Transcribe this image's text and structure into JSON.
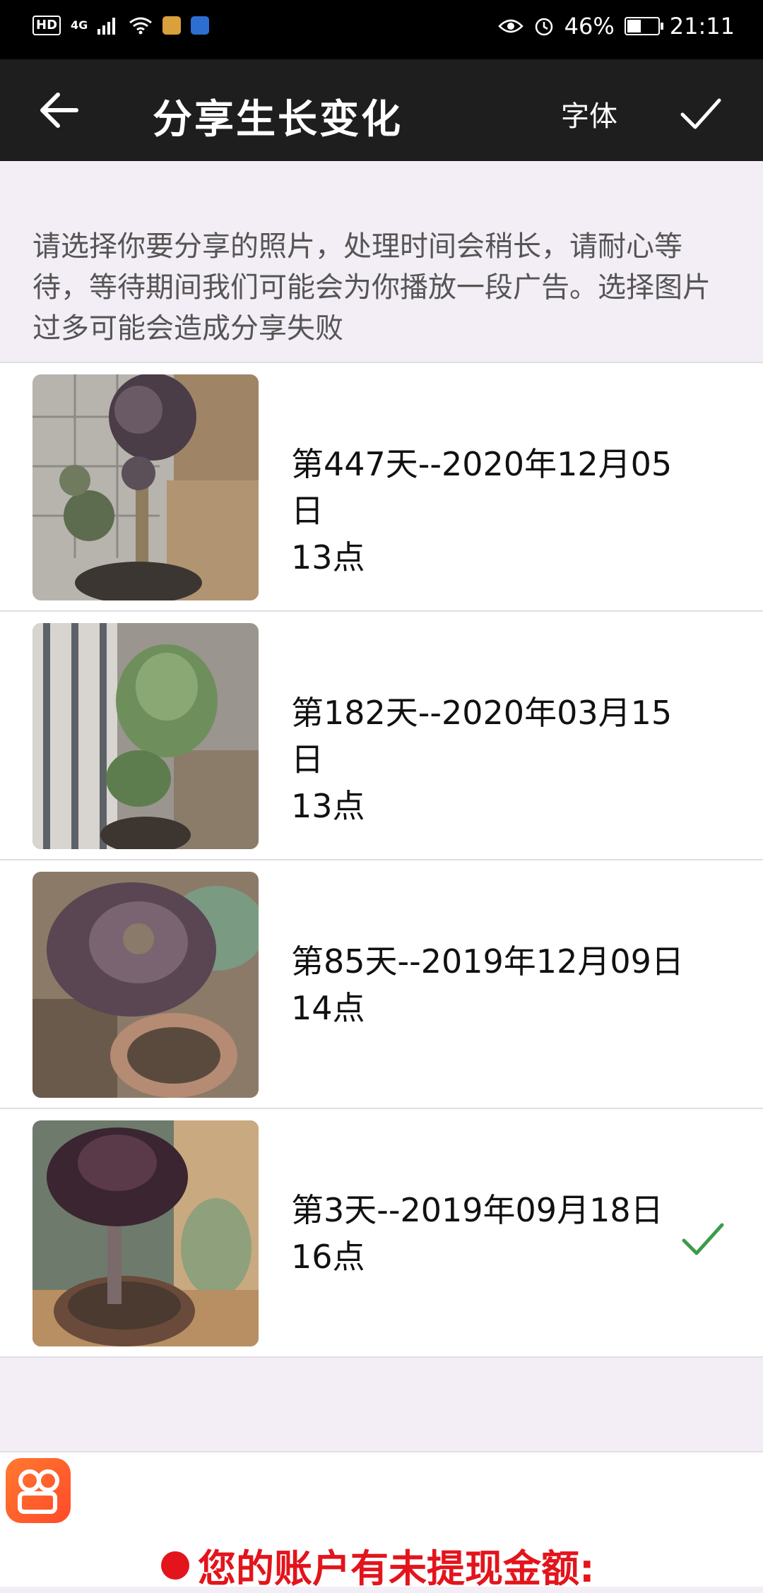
{
  "status_bar": {
    "left_badges": [
      "HD",
      "4G"
    ],
    "battery": "46%",
    "battery_level": 0.46,
    "time": "21:11"
  },
  "header": {
    "title": "分享生长变化",
    "font_label": "字体",
    "back_icon": "arrow-left-icon",
    "confirm_icon": "checkmark-icon"
  },
  "instruction": "请选择你要分享的照片，处理时间会稍长，请耐心等待，等待期间我们可能会为你播放一段广告。选择图片过多可能会造成分享失败",
  "photos": [
    {
      "line1": "第447天--2020年12月05日",
      "line2": "13点",
      "selected": false
    },
    {
      "line1": "第182天--2020年03月15日",
      "line2": "13点",
      "selected": false
    },
    {
      "line1": "第85天--2019年12月09日",
      "line2": "14点",
      "selected": false
    },
    {
      "line1": "第3天--2019年09月18日",
      "line2": "16点",
      "selected": true
    }
  ],
  "ad": {
    "text": "您的账户有未提现金额:"
  },
  "colors": {
    "app_bar": "#1e1e1e",
    "page_bg": "#f3eef5",
    "check_green": "#3d9a4a",
    "ad_red": "#e3141c"
  }
}
